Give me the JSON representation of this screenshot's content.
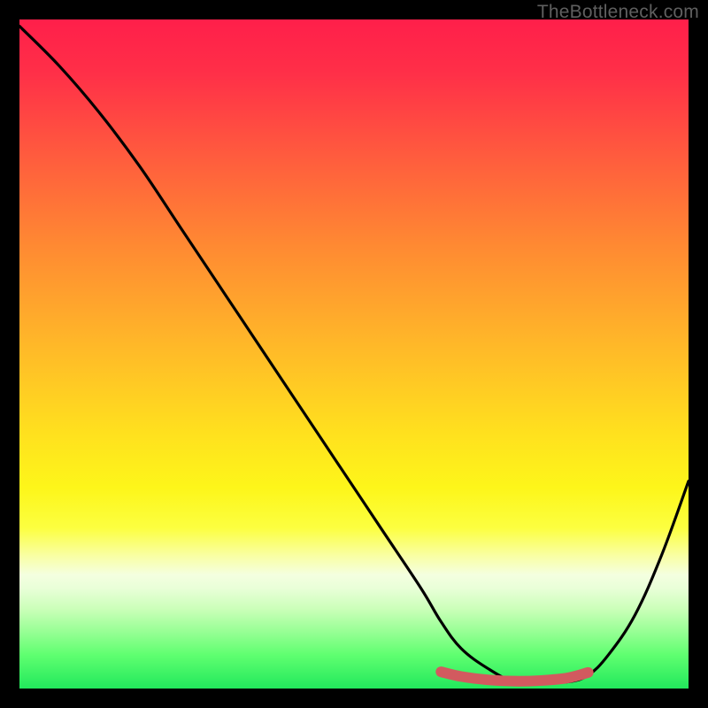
{
  "watermark": "TheBottleneck.com",
  "chart_data": {
    "type": "line",
    "title": "",
    "xlabel": "",
    "ylabel": "",
    "xlim": [
      0,
      100
    ],
    "ylim": [
      0,
      100
    ],
    "series": [
      {
        "name": "bottleneck-curve",
        "x": [
          0,
          6,
          12,
          18,
          24,
          30,
          36,
          42,
          48,
          54,
          60,
          63,
          66,
          70,
          74,
          78,
          82,
          85,
          88,
          92,
          96,
          100
        ],
        "values": [
          99,
          93,
          86,
          78,
          69,
          60,
          51,
          42,
          33,
          24,
          15,
          10,
          6,
          3,
          1,
          1,
          1,
          2,
          5,
          11,
          20,
          31
        ]
      },
      {
        "name": "optimal-band",
        "x": [
          63,
          66,
          70,
          74,
          78,
          82,
          85
        ],
        "values": [
          2.5,
          1.8,
          1.3,
          1.1,
          1.2,
          1.6,
          2.4
        ]
      }
    ],
    "colors": {
      "curve": "#000000",
      "band": "#d25a5f",
      "gradient_top": "#ff1f4a",
      "gradient_bottom": "#22e85c"
    }
  }
}
